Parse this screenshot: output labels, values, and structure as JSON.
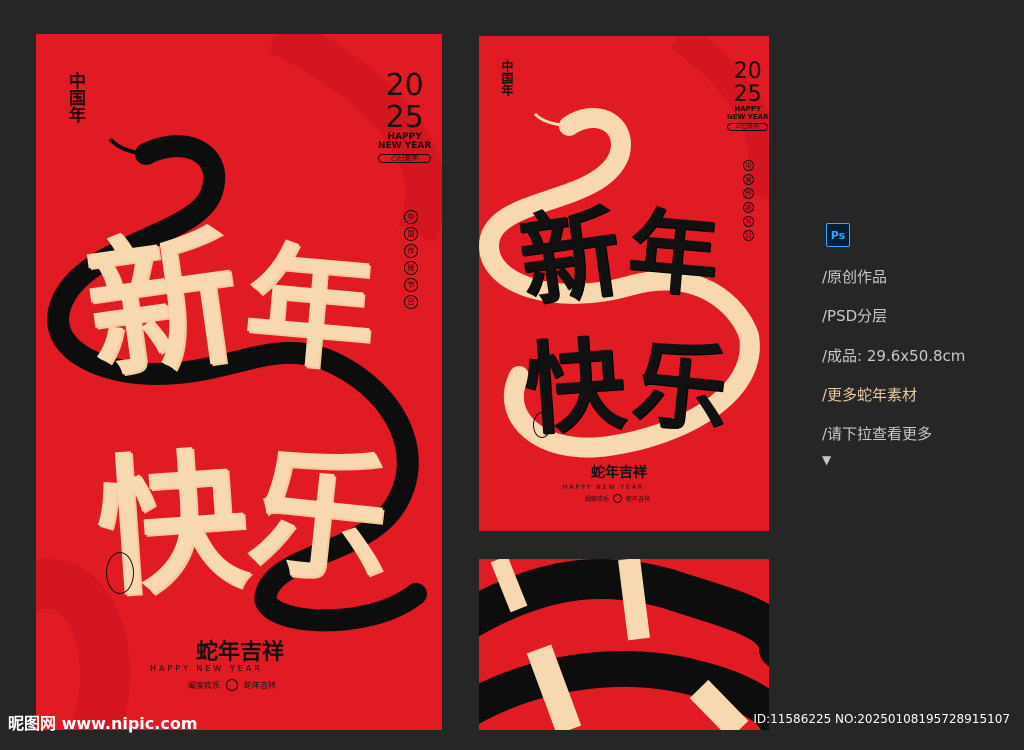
{
  "poster_main": {
    "brand_vertical": "中国年",
    "year_top": "20",
    "year_bottom": "25",
    "happy": "HAPPY",
    "new_year": "NEW YEAR",
    "lunar": "乙巳蛇年",
    "circles": [
      "中",
      "国",
      "传",
      "统",
      "节",
      "日"
    ],
    "headline_1": "新",
    "headline_2": "年",
    "headline_3": "快",
    "headline_4": "乐",
    "bottom_title": "蛇年吉祥",
    "bottom_sub": "HAPPY NEW YEAR",
    "pill_left": "阖家欢乐",
    "pill_right": "蛇年吉祥"
  },
  "poster_second": {
    "brand_vertical": "中国年",
    "year_top": "20",
    "year_bottom": "25",
    "happy": "HAPPY",
    "new_year": "NEW YEAR",
    "lunar": "乙巳蛇年",
    "circles": [
      "中",
      "国",
      "传",
      "统",
      "节",
      "日"
    ],
    "headline_1": "新",
    "headline_2": "年",
    "headline_3": "快",
    "headline_4": "乐",
    "bottom_title": "蛇年吉祥",
    "bottom_sub": "HAPPY NEW YEAR",
    "pill_left": "阖家欢乐",
    "pill_right": "蛇年吉祥"
  },
  "info": {
    "ps_label": "Ps",
    "lines": [
      "/原创作品",
      "/PSD分层",
      "/成品: 29.6x50.8cm",
      "/更多蛇年素材",
      "/请下拉查看更多"
    ],
    "arrow": "▼"
  },
  "watermark": {
    "left": "昵图网 www.nipic.com",
    "right": "ID:11586225 NO:20250108195728915107"
  },
  "colors": {
    "background": "#262626",
    "poster_red": "#e01b24",
    "cream": "#f8d8b0",
    "ink": "#111111",
    "highlight": "#e8c9a4"
  }
}
